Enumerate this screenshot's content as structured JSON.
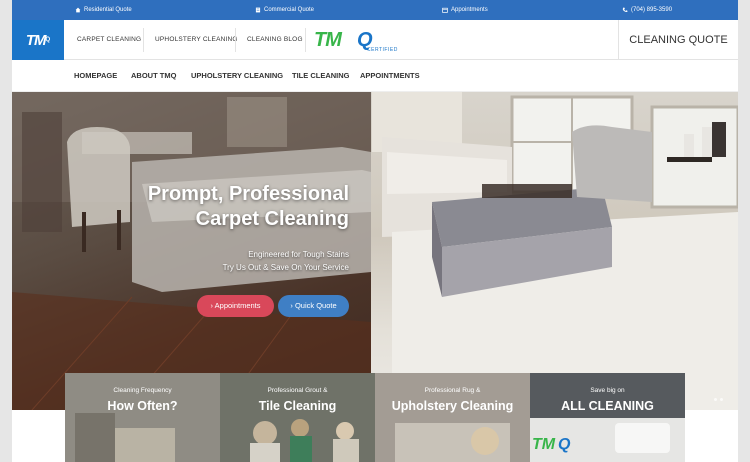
{
  "topbar": {
    "residential": "Residential Quote",
    "commercial": "Commercial Quote",
    "appointments": "Appointments",
    "phone": "(704) 895-3590"
  },
  "header": {
    "logo": "TM",
    "logo_q": "Q",
    "nav": [
      "CARPET CLEANING",
      "UPHOLSTERY CLEANING",
      "CLEANING BLOG"
    ],
    "certified_logo": "TM",
    "certified_q": "Q",
    "certified_text": "CERTIFIED",
    "quote_link": "CLEANING QUOTE"
  },
  "mainnav": [
    "HOMEPAGE",
    "ABOUT TMQ",
    "UPHOLSTERY CLEANING",
    "TILE CLEANING",
    "APPOINTMENTS"
  ],
  "hero": {
    "title_line1": "Prompt, Professional",
    "title_line2": "Carpet Cleaning",
    "sub_line1": "Engineered for Tough Stains",
    "sub_line2": "Try Us Out & Save On Your Service",
    "btn_appointments": "Appointments",
    "btn_quote": "Quick Quote"
  },
  "cards": [
    {
      "small": "Cleaning Frequency",
      "big": "How Often?"
    },
    {
      "small": "Professional Grout &",
      "big": "Tile Cleaning"
    },
    {
      "small": "Professional Rug &",
      "big": "Upholstery Cleaning"
    },
    {
      "small": "Save big on",
      "big": "ALL CLEANING"
    }
  ],
  "colors": {
    "brand_blue": "#2f6fbe",
    "brand_green": "#38b54a",
    "btn_red": "#d9485a",
    "btn_blue": "#3f7fc5"
  }
}
